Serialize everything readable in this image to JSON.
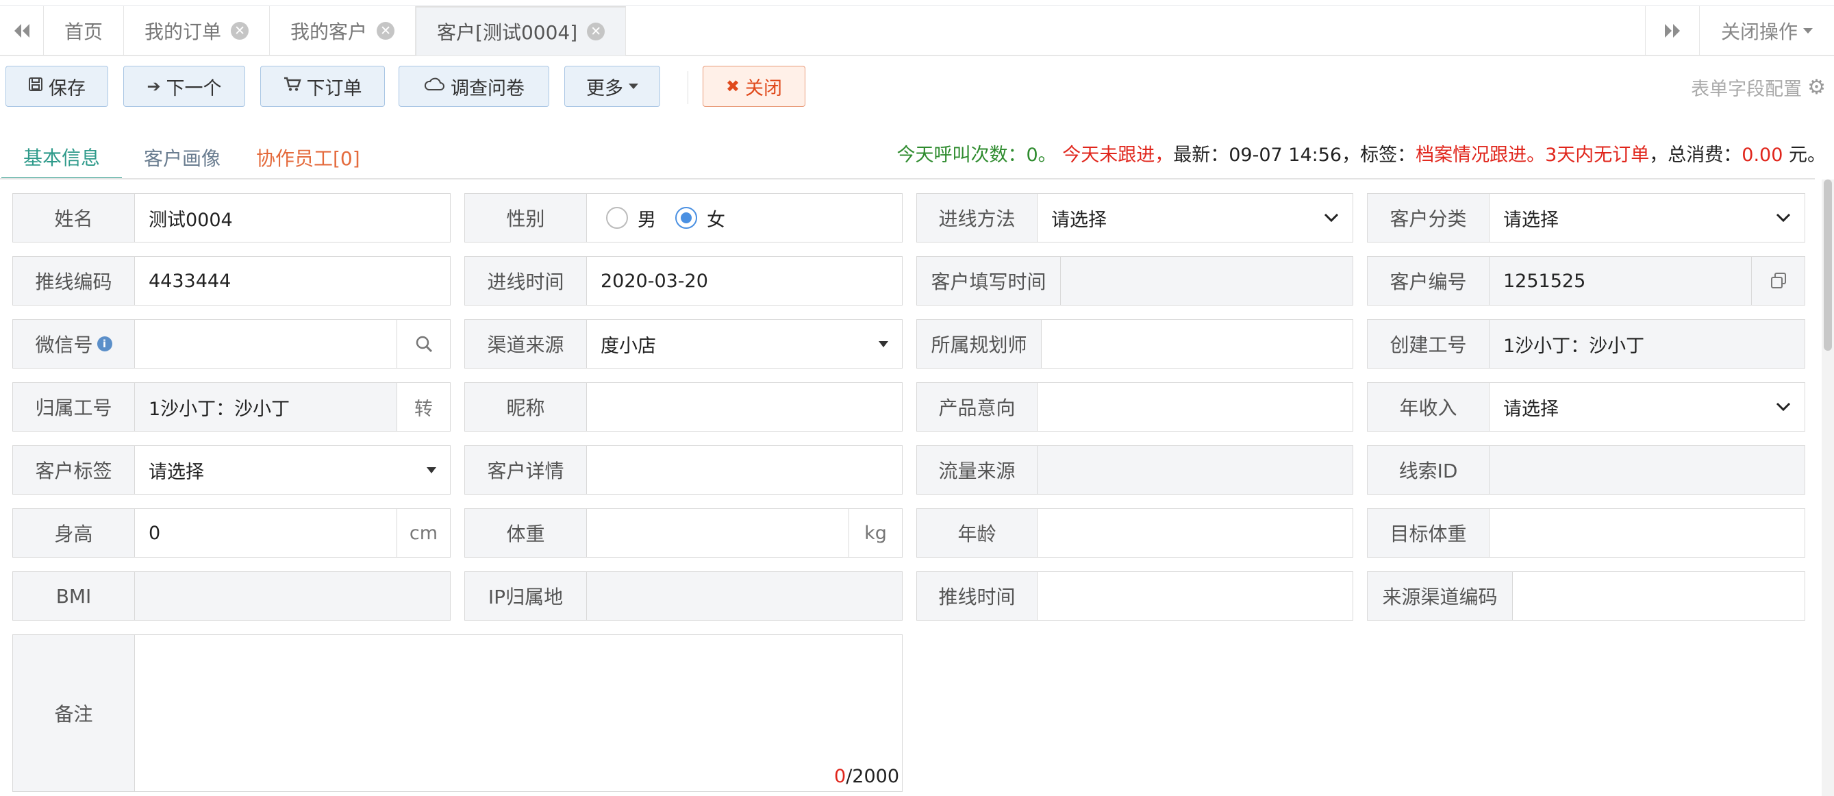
{
  "tabs": [
    {
      "label": "首页",
      "closable": false
    },
    {
      "label": "我的订单",
      "closable": true
    },
    {
      "label": "我的客户",
      "closable": true
    },
    {
      "label": "客户[测试0004]",
      "closable": true,
      "active": true
    }
  ],
  "tab_close_glyph": "✕",
  "close_ops_label": "关闭操作",
  "toolbar": {
    "save": "保存",
    "next": "下一个",
    "order": "下订单",
    "survey": "调查问卷",
    "more": "更多",
    "close": "关闭",
    "form_config": "表单字段配置"
  },
  "subtabs": {
    "basic": "基本信息",
    "portrait": "客户画像",
    "coop": "协作员工[0]"
  },
  "status": {
    "calls_label": "今天呼叫次数：",
    "calls_value": "0",
    "calls_end": "。",
    "not_followed": "今天未跟进",
    "comma1": "，",
    "latest_label": "最新：",
    "latest_value": "09-07 14:56",
    "tag_label": "，标签：",
    "tag_value": "档案情况跟进。3天内无订单",
    "total_label": "，总消费：",
    "total_value": "0.00",
    "total_unit": " 元。"
  },
  "form": {
    "name": {
      "label": "姓名",
      "value": "测试0004"
    },
    "gender": {
      "label": "性别",
      "options": [
        "男",
        "女"
      ],
      "selected": "女"
    },
    "entry_method": {
      "label": "进线方法",
      "value": "请选择"
    },
    "customer_category": {
      "label": "客户分类",
      "value": "请选择"
    },
    "push_code": {
      "label": "推线编码",
      "value": "4433444"
    },
    "entry_time": {
      "label": "进线时间",
      "value": "2020-03-20"
    },
    "fill_time": {
      "label": "客户填写时间",
      "value": ""
    },
    "customer_no": {
      "label": "客户编号",
      "value": "1251525"
    },
    "wechat": {
      "label": "微信号",
      "value": "",
      "info": "i"
    },
    "channel": {
      "label": "渠道来源",
      "value": "度小店"
    },
    "planner": {
      "label": "所属规划师",
      "value": ""
    },
    "creator": {
      "label": "创建工号",
      "value": "1沙小丁：沙小丁"
    },
    "owner": {
      "label": "归属工号",
      "value": "1沙小丁：沙小丁",
      "addon": "转"
    },
    "nickname": {
      "label": "昵称",
      "value": ""
    },
    "product_intent": {
      "label": "产品意向",
      "value": ""
    },
    "annual_income": {
      "label": "年收入",
      "value": "请选择"
    },
    "customer_tag": {
      "label": "客户标签",
      "value": "请选择"
    },
    "customer_detail": {
      "label": "客户详情",
      "value": ""
    },
    "traffic_source": {
      "label": "流量来源",
      "value": ""
    },
    "lead_id": {
      "label": "线索ID",
      "value": ""
    },
    "height": {
      "label": "身高",
      "value": "0",
      "unit": "cm"
    },
    "weight": {
      "label": "体重",
      "value": "",
      "unit": "kg"
    },
    "age": {
      "label": "年龄",
      "value": ""
    },
    "target_weight": {
      "label": "目标体重",
      "value": ""
    },
    "bmi": {
      "label": "BMI",
      "value": ""
    },
    "ip_location": {
      "label": "IP归属地",
      "value": ""
    },
    "push_time": {
      "label": "推线时间",
      "value": ""
    },
    "source_channel_code": {
      "label": "来源渠道编码",
      "value": ""
    },
    "remark": {
      "label": "备注",
      "value": "",
      "count": "0",
      "max": "/2000"
    }
  },
  "colors": {
    "accent_teal": "#2e9a8a",
    "danger": "#e04a1c",
    "status_green": "#2e8b2e",
    "status_red": "#e0251b",
    "button_bg": "#e9f1f9",
    "radio_blue": "#4a90e2"
  }
}
